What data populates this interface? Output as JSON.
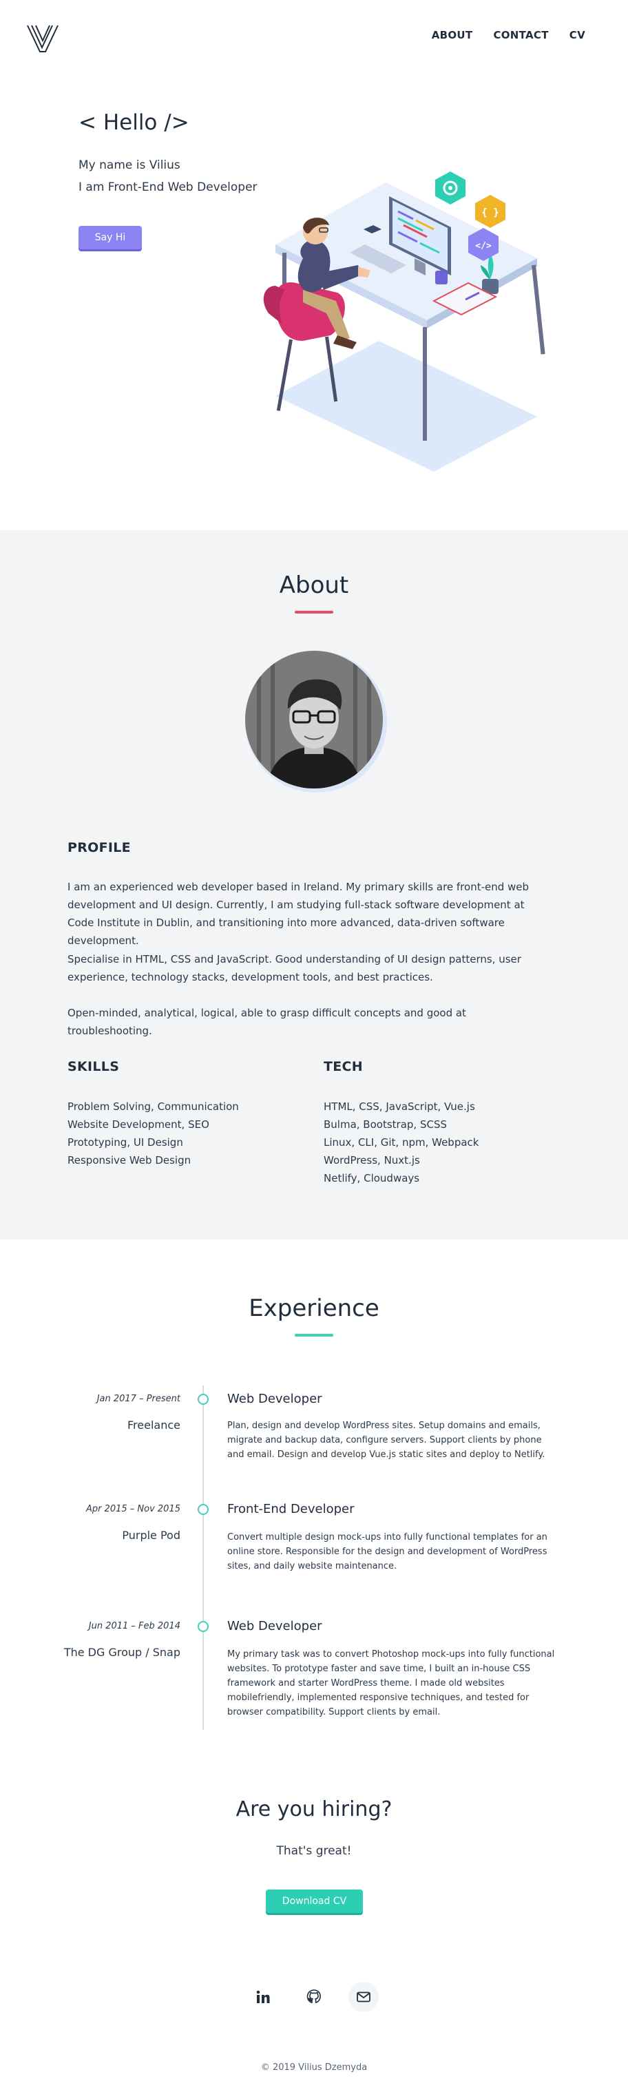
{
  "header": {
    "logo_icon": "v-logo-icon",
    "nav": [
      {
        "label": "ABOUT"
      },
      {
        "label": "CONTACT"
      },
      {
        "label": "CV"
      }
    ]
  },
  "hero": {
    "title": "< Hello />",
    "line1": "My name is Vilius",
    "line2": "I am Front-End Web Developer",
    "button": "Say Hi",
    "button_color": "#8b84f2"
  },
  "about": {
    "title": "About",
    "accent": "#e34d5b",
    "profile_label": "PROFILE",
    "paragraphs": [
      "I am an experienced web developer based in Ireland. My primary skills are front-end web development and UI design. Currently, I am studying full-stack software development at Code Institute in Dublin, and transitioning into more advanced, data-driven software development.",
      "Specialise in HTML, CSS and JavaScript. Good understanding of UI design patterns, user experience, technology stacks, development tools, and best practices.",
      "Open-minded, analytical, logical, able to grasp difficult concepts and good at troubleshooting."
    ],
    "skills_label": "SKILLS",
    "skills": [
      "Problem Solving, Communication",
      "Website Development, SEO",
      "Prototyping, UI Design",
      "Responsive Web Design"
    ],
    "tech_label": "TECH",
    "tech": [
      "HTML, CSS, JavaScript, Vue.js",
      "Bulma, Bootstrap, SCSS",
      "Linux, CLI, Git, npm, Webpack",
      "WordPress, Nuxt.js",
      "Netlify, Cloudways"
    ]
  },
  "experience": {
    "title": "Experience",
    "accent": "#3ed1b8",
    "items": [
      {
        "date": "Jan 2017 – Present",
        "company": "Freelance",
        "role": "Web Developer",
        "desc": "Plan, design and develop WordPress sites. Setup domains and emails, migrate and backup data, configure servers. Support clients by phone and email. Design and develop Vue.js static sites and deploy to Netlify."
      },
      {
        "date": "Apr 2015 – Nov 2015",
        "company": "Purple Pod",
        "role": "Front-End Developer",
        "desc": "Convert multiple design mock-ups into fully functional templates for an online store. Responsible for the design and development of WordPress sites, and daily website maintenance."
      },
      {
        "date": "Jun 2011 – Feb 2014",
        "company": "The DG Group / Snap",
        "role": "Web Developer",
        "desc": "My primary task was to convert Photoshop mock-ups into fully functional websites. To prototype faster and save time, I built an in-house CSS framework and starter WordPress theme. I made old websites mobilefriendly, implemented responsive techniques, and tested for browser compatibility. Support clients by email."
      }
    ]
  },
  "hiring": {
    "title": "Are you hiring?",
    "subtitle": "That's great!",
    "button": "Download CV",
    "button_color": "#2ccfb4"
  },
  "footer": {
    "social": [
      "linkedin-icon",
      "github-icon",
      "email-icon"
    ],
    "copyright": "© 2019 Vilius Dzemyda"
  }
}
